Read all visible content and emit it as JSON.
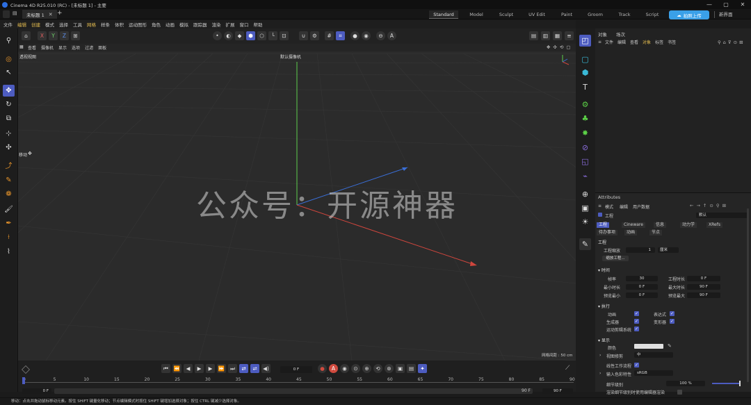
{
  "window": {
    "app_title": "Cinema 4D R25.010 (RC) - [未标题 1] - 主要",
    "controls": [
      "—",
      "▢",
      "✕"
    ]
  },
  "doc_tabs": [
    {
      "label": "未标题 1"
    }
  ],
  "layout_tabs": [
    "Standard",
    "Model",
    "Sculpt",
    "UV Edit",
    "Paint",
    "Groom",
    "Track",
    "Script"
  ],
  "upload_button": "拍照上传",
  "new_ui_label": "新界面",
  "menu": [
    "文件",
    "编辑",
    "创建",
    "模式",
    "选择",
    "工具",
    "网格",
    "样条",
    "体积",
    "运动图形",
    "角色",
    "动画",
    "模拟",
    "跟踪器",
    "渲染",
    "扩展",
    "窗口",
    "帮助"
  ],
  "axis_buttons": [
    "X",
    "Y",
    "Z"
  ],
  "viewport": {
    "menu": [
      "查看",
      "摄像机",
      "显示",
      "选项",
      "过滤",
      "面板"
    ],
    "view_label": "透视视图",
    "camera_label": "默认摄像机",
    "move_label": "移动",
    "grid_label": "网格间距 : 50 cm",
    "watermark": "公众号：开源神器"
  },
  "object_panel": {
    "tabs": [
      "对象",
      "场次"
    ],
    "menu": [
      "文件",
      "编辑",
      "查看",
      "对象",
      "标签",
      "书签"
    ]
  },
  "attributes": {
    "title": "Attributes",
    "menu": [
      "模式",
      "编辑",
      "用户数据"
    ],
    "mode_label": "工程",
    "preset": "默认",
    "subtabs": [
      "工程",
      "Cineware",
      "信息",
      "动力学",
      "XRefs"
    ],
    "subtabs2": [
      "待办事项",
      "动画",
      "节点"
    ],
    "section_project": "工程",
    "project_scale_label": "工程缩放",
    "project_scale_value": "1",
    "project_scale_unit": "厘米",
    "scale_project_btn": "缩放工程...",
    "section_time": "时间",
    "fps_label": "帧率",
    "fps_value": "30",
    "proj_time_label": "工程时长",
    "proj_time_value": "0 F",
    "min_time_label": "最小时长",
    "min_time_value": "0 F",
    "max_time_label": "最大时长",
    "max_time_value": "90 F",
    "prev_min_label": "预览最小",
    "prev_min_value": "0 F",
    "prev_max_label": "预览最大",
    "prev_max_value": "90 F",
    "section_exec": "执行",
    "anim_label": "动画",
    "expr_label": "表达式",
    "gen_label": "生成器",
    "deform_label": "变形器",
    "motion_label": "运动剪辑系统",
    "section_display": "显示",
    "color_label": "颜色",
    "lod_label": "视图修剪",
    "lod_value": "中",
    "linear_label": "线性工作流程",
    "input_color_label": "输入色彩特性",
    "input_color_value": "sRGB",
    "detail_label": "细节级别",
    "detail_value": "100 %",
    "render_lod_label": "渲染细节级别时使用编辑器渲染"
  },
  "timeline": {
    "current_frame": "0 F",
    "start": "0 F",
    "end_a": "90 F",
    "end_b": "90 F",
    "ticks": [
      "0",
      "5",
      "10",
      "15",
      "20",
      "25",
      "30",
      "35",
      "40",
      "45",
      "50",
      "55",
      "60",
      "65",
      "70",
      "75",
      "80",
      "85",
      "90"
    ]
  },
  "status_text": "移动：点击并拖动鼠标移动元素。按住 SHIFT 键量化移动；节点编辑模式时按住 SHIFT 键增加选择对象；按住 CTRL 键减少选择对象。",
  "colors": {
    "accent": "#4d5cc0",
    "upload": "#3aa0e8",
    "axis_x": "#d0463d",
    "axis_y": "#5dcf4e",
    "axis_z": "#3a6fd8"
  }
}
